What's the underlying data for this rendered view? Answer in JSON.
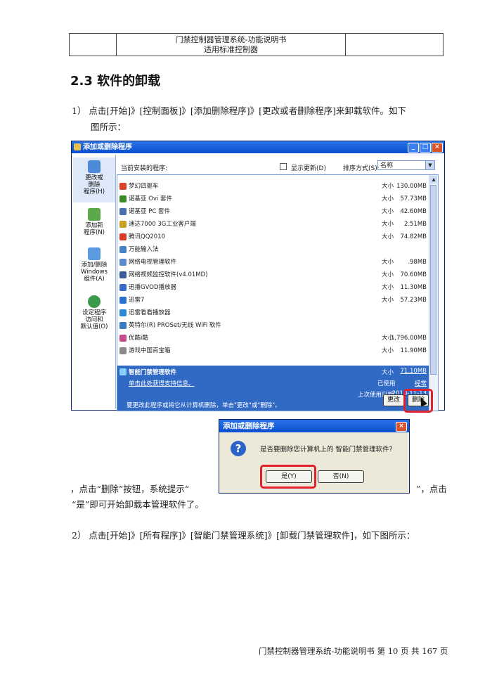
{
  "header": {
    "line1": "门禁控制器管理系统-功能说明书",
    "line2": "适用标准控制器"
  },
  "section_title": "2.3 软件的卸载",
  "step1": {
    "text": "1）  点击[开始]》[控制面板]》[添加删除程序]》[更改或者删除程序]来卸载软件。如下",
    "cont": "图所示："
  },
  "window": {
    "title": "添加或删除程序",
    "controls": {
      "min": "_",
      "max": "□",
      "close": "×"
    },
    "sidebar": [
      {
        "label": "更改或\n删除\n程序(H)",
        "icon": "change-remove-icon"
      },
      {
        "label": "添加新\n程序(N)",
        "icon": "add-program-icon"
      },
      {
        "label": "添加/删除\nWindows\n组件(A)",
        "icon": "windows-components-icon"
      },
      {
        "label": "设定程序\n访问和\n默认值(O)",
        "icon": "program-defaults-icon"
      }
    ],
    "current_label": "当前安装的程序:",
    "show_updates_label": "显示更新(D)",
    "sort_label": "排序方式(S):",
    "sort_value": "名称",
    "size_label": "大小",
    "programs": [
      {
        "name": "梦幻四驱车",
        "size": "130.00MB",
        "color": "#d8432a"
      },
      {
        "name": "诺基亚 Ovi 套件",
        "size": "57.73MB",
        "color": "#3a8a2a"
      },
      {
        "name": "诺基亚 PC 套件",
        "size": "42.60MB",
        "color": "#4a6fb0"
      },
      {
        "name": "速达7000 3G工业客户端",
        "size": "2.51MB",
        "color": "#c6a020"
      },
      {
        "name": "腾讯QQ2010",
        "size": "74.82MB",
        "color": "#d83a2a"
      },
      {
        "name": "万能输入法",
        "size": "",
        "color": "#4a80c8"
      },
      {
        "name": "网络电视管理软件",
        "size": ".98MB",
        "color": "#5a8ad0"
      },
      {
        "name": "网络视频监控软件(v4.01MD)",
        "size": "70.60MB",
        "color": "#3a5a9a"
      },
      {
        "name": "迅播GVOD播放器",
        "size": "11.30MB",
        "color": "#3a6ac8"
      },
      {
        "name": "迅雷7",
        "size": "57.23MB",
        "color": "#2a70d0"
      },
      {
        "name": "迅雷看看播放器",
        "size": "",
        "color": "#2a8ad8"
      },
      {
        "name": "英特尔(R) PROSet/无线 WiFi 软件",
        "size": "",
        "color": "#3a7ac0"
      },
      {
        "name": "优酷i酷",
        "size": "1,796.00MB",
        "color": "#c84a8a"
      },
      {
        "name": "游戏中国百宝箱",
        "size": "11.90MB",
        "color": "#8a8a8a"
      }
    ],
    "selected": {
      "name": "智能门禁管理软件",
      "support_link": "单击此处获得支持信息。",
      "size_label": "大小",
      "size": "71.10MB",
      "used_label": "已使用",
      "used": "经常",
      "last_used_label": "上次使用日期",
      "last_used": "2010-11-13",
      "note": "要更改此程序或将它从计算机删除，单击\"更改\"或\"删除\"。"
    },
    "change_button": "更改",
    "remove_button": "删除"
  },
  "dialog": {
    "title": "添加或删除程序",
    "close": "×",
    "icon": "?",
    "message": "是否要删除您计算机上的 智能门禁管理软件?",
    "yes_button": "是(Y)",
    "no_button": "否(N)"
  },
  "step1_result": {
    "before": "，点击“删除”按钮，系统提示“",
    "after": "”，点击",
    "line2": "“是”即可开始卸载本管理软件了。"
  },
  "step2": {
    "text": "2）  点击[开始]》[所有程序]》[智能门禁管理系统]》[卸载门禁管理软件]，如下图所示："
  },
  "footer": "门禁控制器管理系统-功能说明书  第 10 页 共 167 页"
}
